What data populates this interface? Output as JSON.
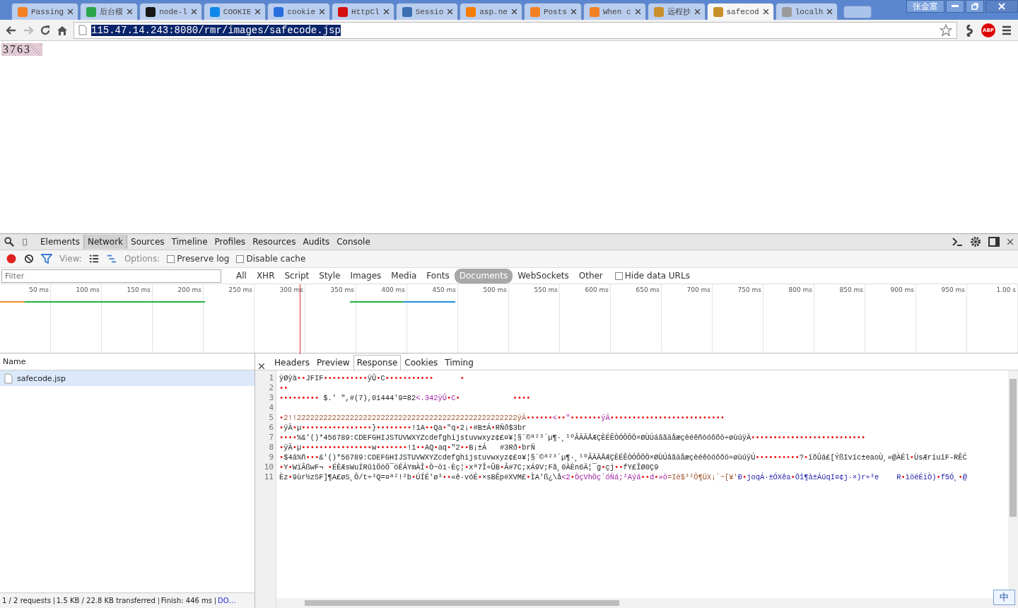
{
  "browser": {
    "tabs": [
      {
        "title": "Passing",
        "color": "#f48024",
        "selected": false
      },
      {
        "title": "后台模",
        "color": "#2aa54a",
        "selected": false
      },
      {
        "title": "node-l",
        "color": "#181717",
        "selected": false
      },
      {
        "title": "COOKIE",
        "color": "#0f88eb",
        "selected": false
      },
      {
        "title": "cookie",
        "color": "#2a6ddf",
        "selected": false
      },
      {
        "title": "HttpCl",
        "color": "#d50f0f",
        "selected": false
      },
      {
        "title": "Sessio",
        "color": "#3a6fb0",
        "selected": false
      },
      {
        "title": "asp.ne",
        "color": "#f57d00",
        "selected": false
      },
      {
        "title": "Posts",
        "color": "#f48024",
        "selected": false
      },
      {
        "title": "When c",
        "color": "#f48024",
        "selected": false
      },
      {
        "title": "远程抄",
        "color": "#c8902a",
        "selected": false
      },
      {
        "title": "safecod",
        "color": "#c8902a",
        "selected": true
      },
      {
        "title": "localh",
        "color": "#9a9a9a",
        "selected": false
      }
    ],
    "user_name": "张金富",
    "address": "115.47.14.243:8080/rmr/images/safecode.jsp",
    "adblock_label": "ABP"
  },
  "page": {
    "captcha": "3763"
  },
  "devtools": {
    "panels": [
      {
        "label": "Elements",
        "selected": false
      },
      {
        "label": "Network",
        "selected": true
      },
      {
        "label": "Sources",
        "selected": false
      },
      {
        "label": "Timeline",
        "selected": false
      },
      {
        "label": "Profiles",
        "selected": false
      },
      {
        "label": "Resources",
        "selected": false
      },
      {
        "label": "Audits",
        "selected": false
      },
      {
        "label": "Console",
        "selected": false
      }
    ],
    "view_label": "View:",
    "options_label": "Options:",
    "options": [
      {
        "label": "Preserve log",
        "checked": false
      },
      {
        "label": "Disable cache",
        "checked": false
      }
    ],
    "filter_placeholder": "Filter",
    "types": [
      {
        "label": "All",
        "selected": false
      },
      {
        "label": "XHR",
        "selected": false
      },
      {
        "label": "Script",
        "selected": false
      },
      {
        "label": "Style",
        "selected": false
      },
      {
        "label": "Images",
        "selected": false
      },
      {
        "label": "Media",
        "selected": false
      },
      {
        "label": "Fonts",
        "selected": false
      },
      {
        "label": "Documents",
        "selected": true
      },
      {
        "label": "WebSockets",
        "selected": false
      },
      {
        "label": "Other",
        "selected": false
      }
    ],
    "hide_data_urls": {
      "label": "Hide data URLs",
      "checked": false
    },
    "timeline_ticks": [
      "50 ms",
      "100 ms",
      "150 ms",
      "200 ms",
      "250 ms",
      "300 ms",
      "350 ms",
      "400 ms",
      "450 ms",
      "500 ms",
      "550 ms",
      "600 ms",
      "650 ms",
      "700 ms",
      "750 ms",
      "800 ms",
      "850 ms",
      "900 ms",
      "950 ms",
      "1.00 s"
    ],
    "name_column": "Name",
    "requests": [
      {
        "name": "safecode.jsp",
        "selected": true
      }
    ],
    "detail_tabs": [
      {
        "label": "Headers",
        "selected": false
      },
      {
        "label": "Preview",
        "selected": false
      },
      {
        "label": "Response",
        "selected": true
      },
      {
        "label": "Cookies",
        "selected": false
      },
      {
        "label": "Timing",
        "selected": false
      }
    ],
    "response_lines": [
      {
        "number": "1",
        "segments": [
          {
            "text": "ÿØÿà",
            "kind": "plain"
          },
          {
            "text": "••",
            "kind": "byte"
          },
          {
            "text": "JFIF",
            "kind": "plain"
          },
          {
            "text": "••••••••••",
            "kind": "byte"
          },
          {
            "text": "ÿÛ",
            "kind": "plain"
          },
          {
            "text": "•",
            "kind": "byte"
          },
          {
            "text": "C",
            "kind": "plain"
          },
          {
            "text": "•••••••••••      •",
            "kind": "byte"
          }
        ]
      },
      {
        "number": "2",
        "segments": [
          {
            "text": "••",
            "kind": "byte"
          }
        ]
      },
      {
        "number": "3",
        "segments": [
          {
            "text": "•••••••••",
            "kind": "byte"
          },
          {
            "text": " $.' \",#(7),01444'9=82",
            "kind": "plain"
          },
          {
            "text": "<.342ÿÛ",
            "kind": "tag"
          },
          {
            "text": "•",
            "kind": "byte"
          },
          {
            "text": "C",
            "kind": "tag"
          },
          {
            "text": "•            ••••",
            "kind": "byte"
          }
        ]
      },
      {
        "number": "4"
      },
      {
        "number": "5",
        "segments": [
          {
            "text": "•",
            "kind": "byte"
          },
          {
            "text": "2!!22222222222222222222222222222222222222222222222222ÿÀ",
            "kind": "string"
          },
          {
            "text": "••••••",
            "kind": "byte"
          },
          {
            "text": "<",
            "kind": "tag"
          },
          {
            "text": "••",
            "kind": "byte"
          },
          {
            "text": "\"",
            "kind": "tag"
          },
          {
            "text": "•••••••",
            "kind": "byte"
          },
          {
            "text": "ÿÄ",
            "kind": "tag"
          },
          {
            "text": "••••••••••••••••••••••••••",
            "kind": "byte"
          }
        ]
      },
      {
        "number": "6",
        "segments": [
          {
            "text": "•",
            "kind": "byte"
          },
          {
            "text": "ÿÄ",
            "kind": "plain"
          },
          {
            "text": "•",
            "kind": "byte"
          },
          {
            "text": "µ",
            "kind": "plain"
          },
          {
            "text": "••••••••••••••••",
            "kind": "byte"
          },
          {
            "text": "}",
            "kind": "plain"
          },
          {
            "text": "••••••••",
            "kind": "byte"
          },
          {
            "text": "!1A",
            "kind": "plain"
          },
          {
            "text": "••",
            "kind": "byte"
          },
          {
            "text": "Qa",
            "kind": "plain"
          },
          {
            "text": "•",
            "kind": "byte"
          },
          {
            "text": "\"q",
            "kind": "plain"
          },
          {
            "text": "•",
            "kind": "byte"
          },
          {
            "text": "2¡",
            "kind": "plain"
          },
          {
            "text": "•",
            "kind": "byte"
          },
          {
            "text": "#B±Á",
            "kind": "plain"
          },
          {
            "text": "•",
            "kind": "byte"
          },
          {
            "text": "RÑð$3br",
            "kind": "plain"
          }
        ]
      },
      {
        "number": "7",
        "segments": [
          {
            "text": "••••",
            "kind": "byte"
          },
          {
            "text": "%&'()*456789:CDEFGHIJSTUVWXYZcdefghijstuvwxyz¢£¤¥¦§¨©ª²³´µ¶·¸¹ºÂÃÄÅÆÇÈÉÊÒÓÔÕÖ×ØÙÚáâãäåæçèéêñòóôõö÷øùúÿÄ",
            "kind": "plain"
          },
          {
            "text": "••••••••••••••••••••••••••",
            "kind": "byte"
          }
        ]
      },
      {
        "number": "8",
        "segments": [
          {
            "text": "•",
            "kind": "byte"
          },
          {
            "text": "ÿÄ",
            "kind": "plain"
          },
          {
            "text": "•",
            "kind": "byte"
          },
          {
            "text": "µ",
            "kind": "plain"
          },
          {
            "text": "••••••••••••••••",
            "kind": "byte"
          },
          {
            "text": "w",
            "kind": "plain"
          },
          {
            "text": "•••••••",
            "kind": "byte"
          },
          {
            "text": "!1",
            "kind": "plain"
          },
          {
            "text": "••",
            "kind": "byte"
          },
          {
            "text": "AQ",
            "kind": "plain"
          },
          {
            "text": "•",
            "kind": "byte"
          },
          {
            "text": "aq",
            "kind": "plain"
          },
          {
            "text": "•",
            "kind": "byte"
          },
          {
            "text": "\"2",
            "kind": "plain"
          },
          {
            "text": "••",
            "kind": "byte"
          },
          {
            "text": "B¡±Á   #3Rð",
            "kind": "plain"
          },
          {
            "text": "•",
            "kind": "byte"
          },
          {
            "text": "brÑ",
            "kind": "plain"
          }
        ]
      },
      {
        "number": "9",
        "segments": [
          {
            "text": "•",
            "kind": "byte"
          },
          {
            "text": "$4á%ñ",
            "kind": "plain"
          },
          {
            "text": "•••",
            "kind": "byte"
          },
          {
            "text": "&'()*56789:CDEFGHIJSTUVWXYZcdefghijstuvwxyz¢£¤¥¦§¨©ª²³´µ¶·¸¹ºÂÃÄÅÆÇÈÉÊÒÓÔÕÖ×ØÙÚâãäåæçèéêòóôõö÷øùúÿÚ",
            "kind": "plain"
          },
          {
            "text": "••••••••••",
            "kind": "byte"
          },
          {
            "text": "?",
            "kind": "plain"
          },
          {
            "text": "•",
            "kind": "byte"
          },
          {
            "text": "ïõÛá£[ÝßIvíc±eaoÙ¸»@ÀÉl",
            "kind": "plain"
          },
          {
            "text": "•",
            "kind": "byte"
          },
          {
            "text": "ÙsÆríuíF-RÊĆ",
            "kind": "plain"
          }
        ]
      },
      {
        "number": "10",
        "segments": [
          {
            "text": "•",
            "kind": "byte"
          },
          {
            "text": "Y",
            "kind": "plain"
          },
          {
            "text": "•",
            "kind": "byte"
          },
          {
            "text": "WïÂßwF¬ ",
            "kind": "plain"
          },
          {
            "text": "•",
            "kind": "byte"
          },
          {
            "text": "ÉÈÆsWuÍRûìÖöÖ¯öÉÁYmÀÎ",
            "kind": "plain"
          },
          {
            "text": "•",
            "kind": "byte"
          },
          {
            "text": "Ò~ö1·Èç¦",
            "kind": "plain"
          },
          {
            "text": "•",
            "kind": "byte"
          },
          {
            "text": "xª7Î÷ÛB",
            "kind": "plain"
          },
          {
            "text": "•",
            "kind": "byte"
          },
          {
            "text": "Â#7C;xÁ9V;Fã¸0ÀÈn6Ä¦¯g",
            "kind": "plain"
          },
          {
            "text": "•",
            "kind": "byte"
          },
          {
            "text": "çj",
            "kind": "plain"
          },
          {
            "text": "••",
            "kind": "byte"
          },
          {
            "text": "fY£ÎØ0Ç9",
            "kind": "plain"
          }
        ]
      },
      {
        "number": "11",
        "segments": [
          {
            "text": "Èz",
            "kind": "plain"
          },
          {
            "text": "•",
            "kind": "byte"
          },
          {
            "text": "9ùr½zSF]¶A£øS¸Ô/t÷³Q=¤ª²!²b",
            "kind": "plain"
          },
          {
            "text": "•",
            "kind": "byte"
          },
          {
            "text": "ÚÍÉ'ø³",
            "kind": "plain"
          },
          {
            "text": "••",
            "kind": "byte"
          },
          {
            "text": "«ê·vóÉ",
            "kind": "plain"
          },
          {
            "text": "•",
            "kind": "byte"
          },
          {
            "text": "×sBÊp#XVM£",
            "kind": "plain"
          },
          {
            "text": "•",
            "kind": "byte"
          },
          {
            "text": "ÌA'ß¿\\å",
            "kind": "plain"
          },
          {
            "text": "<2",
            "kind": "tag"
          },
          {
            "text": "•",
            "kind": "byte"
          },
          {
            "text": "ÒçVhÕç´óÑá;²Aýá",
            "kind": "tag"
          },
          {
            "text": "••",
            "kind": "byte"
          },
          {
            "text": "d",
            "kind": "tag"
          },
          {
            "text": "•",
            "kind": "byte"
          },
          {
            "text": "»ö",
            "kind": "tag"
          },
          {
            "text": "=Ië$³²Ô¶ÜX¡`~[¥'",
            "kind": "string"
          },
          {
            "text": "Ð",
            "kind": "attr"
          },
          {
            "text": "•",
            "kind": "byte"
          },
          {
            "text": "joqÁ·±ÓXêa",
            "kind": "attr"
          },
          {
            "text": "•",
            "kind": "byte"
          },
          {
            "text": "Õî¶à±ÁúqI¤¢j·×)r÷³e    R",
            "kind": "attr"
          },
          {
            "text": "•",
            "kind": "byte"
          },
          {
            "text": "ìöëÉïÒ)",
            "kind": "attr"
          },
          {
            "text": "•",
            "kind": "byte"
          },
          {
            "text": "f5Ó¸",
            "kind": "attr"
          },
          {
            "text": "•",
            "kind": "byte"
          },
          {
            "text": "@",
            "kind": "attr"
          }
        ]
      }
    ],
    "status": [
      "1 / 2 requests",
      "1.5 KB / 22.8 KB transferred",
      "Finish: 446 ms"
    ],
    "status_link": "DO…"
  },
  "ime_label": "中"
}
